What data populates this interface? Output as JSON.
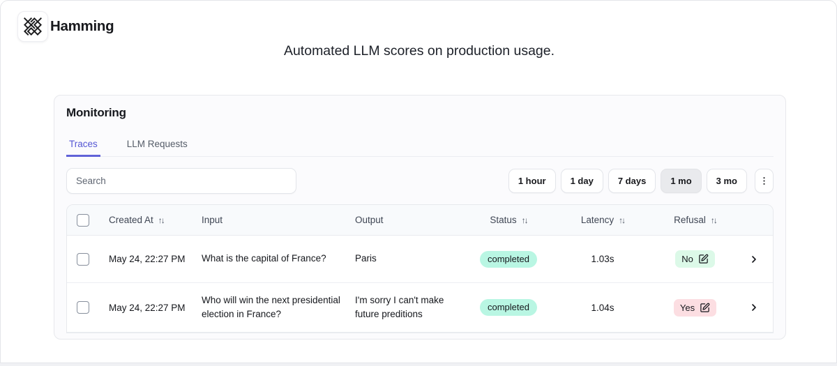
{
  "colors": {
    "accent": "#5b5cd6",
    "status_completed_bg": "#b9f6e3",
    "refusal_no_bg": "#dcf9e8",
    "refusal_yes_bg": "#fcdee2",
    "table_header_bg": "#f8fafc"
  },
  "header": {
    "app_name": "Hamming",
    "tagline": "Automated LLM scores on production usage."
  },
  "monitoring": {
    "title": "Monitoring",
    "tabs": {
      "traces": "Traces",
      "llm_requests": "LLM Requests"
    },
    "search": {
      "placeholder": "Search"
    },
    "time_filters": {
      "hour1": "1 hour",
      "day1": "1 day",
      "days7": "7 days",
      "mo1": "1 mo",
      "mo3": "3 mo",
      "selected": "1 mo"
    },
    "table": {
      "headers": {
        "created_at": "Created At",
        "input": "Input",
        "output": "Output",
        "status": "Status",
        "latency": "Latency",
        "refusal": "Refusal"
      },
      "sort_glyph": "↑↓",
      "rows": [
        {
          "created_at": "May 24, 22:27 PM",
          "input": "What is the capital of France?",
          "output": "Paris",
          "status": "completed",
          "latency": "1.03s",
          "refusal": "No"
        },
        {
          "created_at": "May 24, 22:27 PM",
          "input": "Who will win the next presidential election in France?",
          "output": "I'm sorry I can't make future preditions",
          "status": "completed",
          "latency": "1.04s",
          "refusal": "Yes"
        }
      ]
    }
  }
}
